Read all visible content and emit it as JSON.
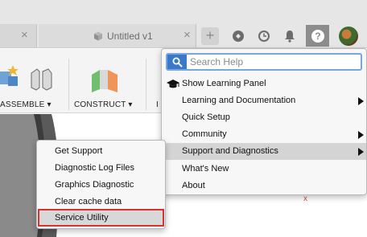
{
  "tabs": [
    {
      "label": "",
      "close": "×"
    },
    {
      "label": "Untitled v1",
      "close": "×"
    }
  ],
  "topbar": {
    "add_tab": "+",
    "icons": [
      "extensions-icon",
      "job-status-icon",
      "notifications-bell-icon",
      "help-icon",
      "user-avatar"
    ]
  },
  "ribbon": {
    "assemble_label": "ASSEMBLE ▾",
    "construct_label": "CONSTRUCT ▾",
    "inspect_label": "I"
  },
  "help_menu": {
    "search_placeholder": "Search Help",
    "items": [
      {
        "label": "Show Learning Panel",
        "icon": "graduation-cap-icon",
        "submenu": false
      },
      {
        "label": "Learning and Documentation",
        "submenu": true
      },
      {
        "label": "Quick Setup",
        "submenu": false
      },
      {
        "label": "Community",
        "submenu": true
      },
      {
        "label": "Support and Diagnostics",
        "submenu": true,
        "highlighted": true
      },
      {
        "label": "What's New",
        "submenu": false
      },
      {
        "label": "About",
        "submenu": false
      }
    ]
  },
  "support_menu": {
    "items": [
      {
        "label": "Get Support"
      },
      {
        "label": "Diagnostic Log Files"
      },
      {
        "label": "Graphics Diagnostic"
      },
      {
        "label": "Clear cache data"
      },
      {
        "label": "Service Utility",
        "outlined": true
      }
    ]
  },
  "canvas": {
    "marker": "x"
  },
  "colors": {
    "accent": "#3a79c8",
    "highlight_outline": "#d93030",
    "help_button_bg": "#8c8c8c"
  }
}
